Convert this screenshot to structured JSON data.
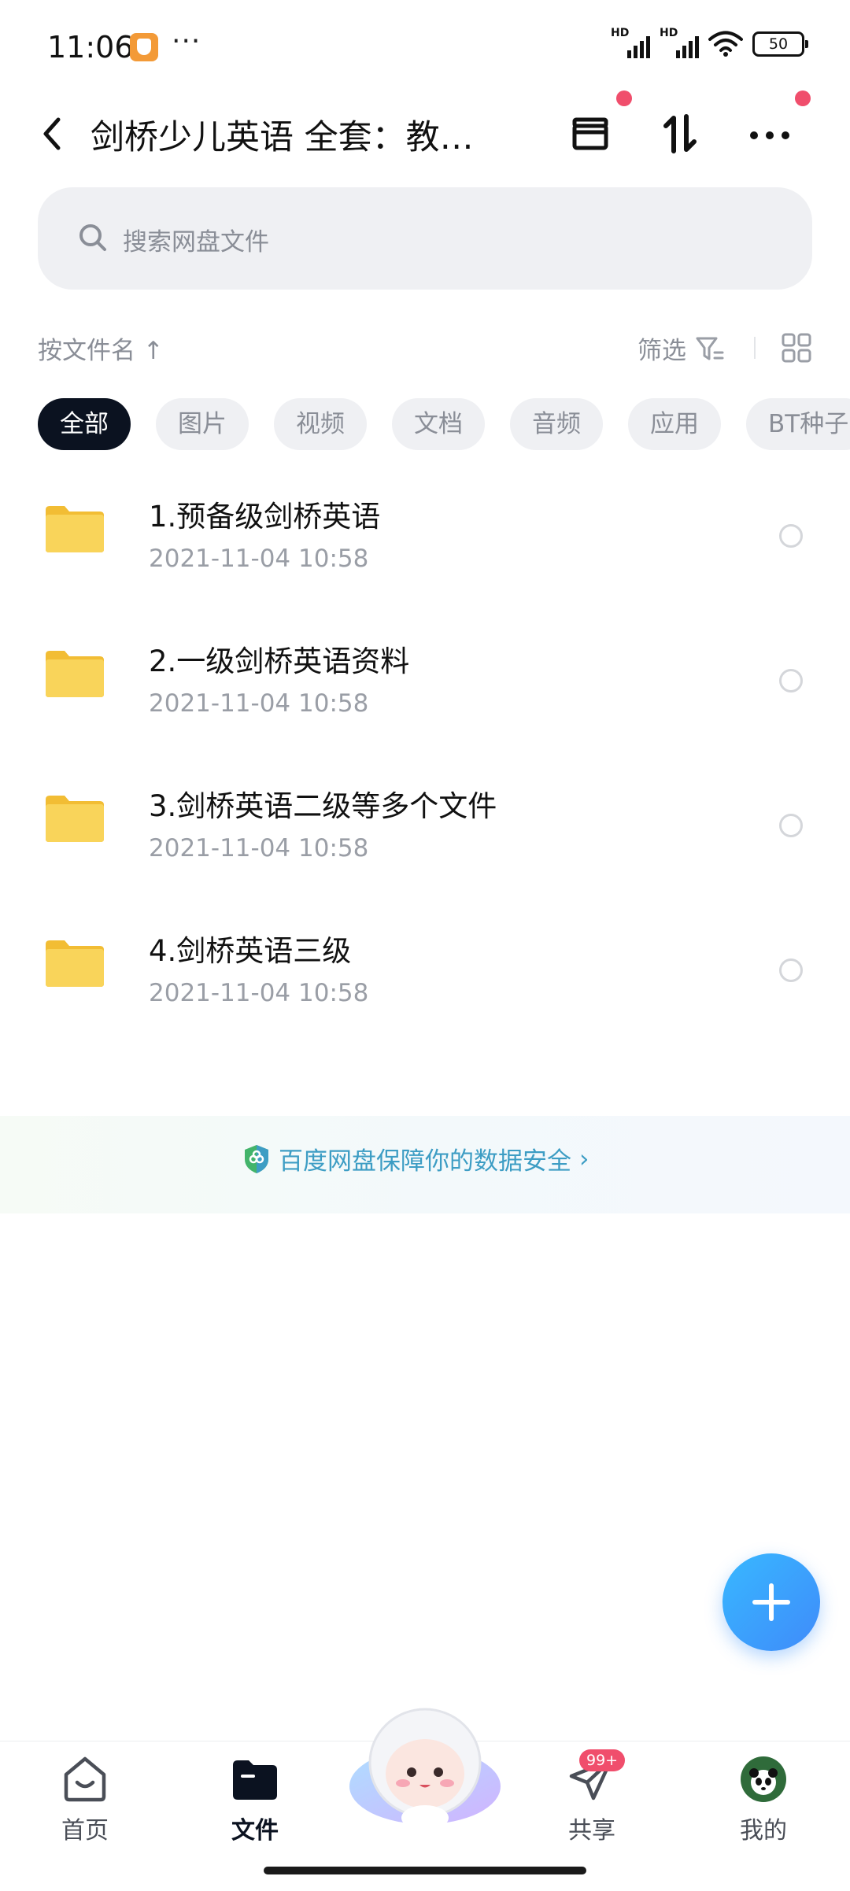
{
  "status_bar": {
    "time": "11:06",
    "more_dots": "···",
    "signal1_label": "HD",
    "signal2_label": "HD",
    "battery": "50"
  },
  "header": {
    "title": "剑桥少儿英语 全套：教…",
    "icons": [
      "back-arrow-icon",
      "archive-box-icon",
      "sort-arrows-icon",
      "more-icon"
    ]
  },
  "search": {
    "placeholder": "搜索网盘文件"
  },
  "sort": {
    "label": "按文件名 ↑",
    "filter_label": "筛选"
  },
  "chips": [
    {
      "label": "全部",
      "active": true
    },
    {
      "label": "图片",
      "active": false
    },
    {
      "label": "视频",
      "active": false
    },
    {
      "label": "文档",
      "active": false
    },
    {
      "label": "音频",
      "active": false
    },
    {
      "label": "应用",
      "active": false
    },
    {
      "label": "BT种子",
      "active": false
    }
  ],
  "files": [
    {
      "name": "1.预备级剑桥英语",
      "date": "2021-11-04  10:58"
    },
    {
      "name": "2.一级剑桥英语资料",
      "date": "2021-11-04  10:58"
    },
    {
      "name": "3.剑桥英语二级等多个文件",
      "date": "2021-11-04  10:58"
    },
    {
      "name": "4.剑桥英语三级",
      "date": "2021-11-04  10:58"
    }
  ],
  "banner": {
    "text": "百度网盘保障你的数据安全",
    "chevron": "›"
  },
  "tabbar": {
    "tabs": [
      {
        "label": "首页",
        "icon": "home-icon"
      },
      {
        "label": "文件",
        "icon": "folder-icon",
        "active": true
      },
      {
        "label": "共享",
        "icon": "send-icon",
        "badge": "99+"
      },
      {
        "label": "我的",
        "icon": "avatar-icon"
      }
    ]
  },
  "colors": {
    "accent_blue": "#3f8bfa",
    "banner_text": "#3d9dc4",
    "red_dot": "#f04e6c",
    "active_chip": "#0b1220",
    "folder_yellow": "#f7cc4a"
  }
}
